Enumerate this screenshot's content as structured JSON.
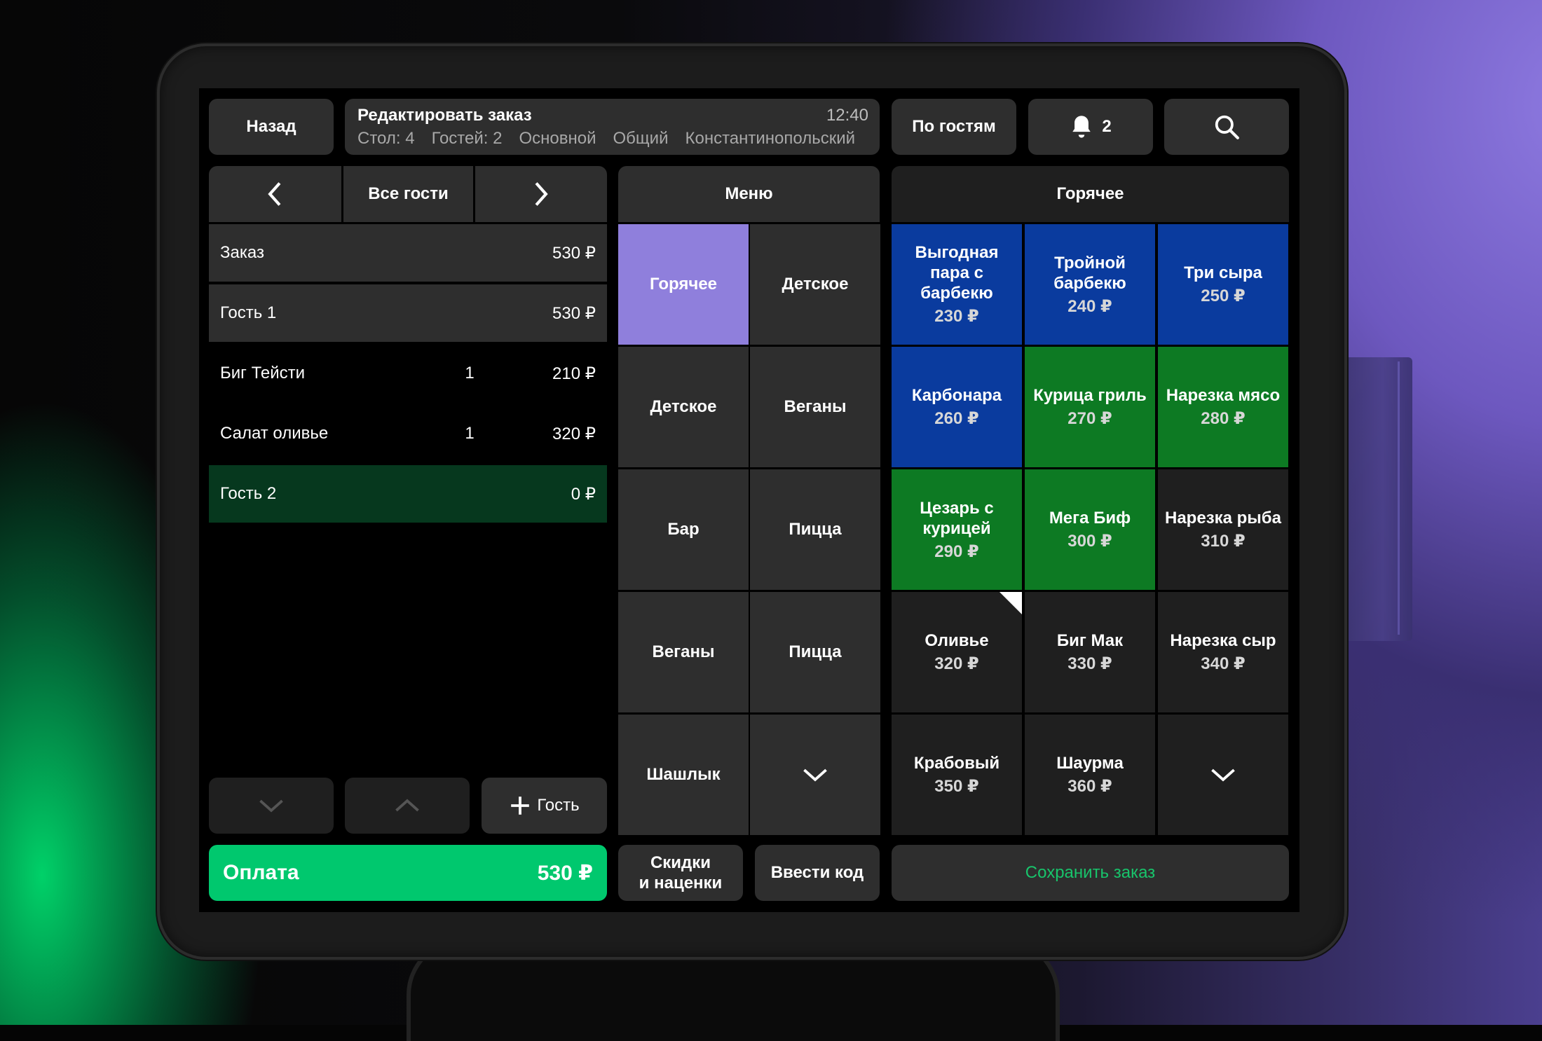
{
  "header": {
    "back_label": "Назад",
    "title": "Редактировать заказ",
    "time": "12:40",
    "table": "Стол: 4",
    "guests": "Гостей: 2",
    "hall": "Основной",
    "menu_type": "Общий",
    "waiter": "Константинопольский",
    "by_guests_label": "По гостям",
    "notifications_count": "2"
  },
  "guest_nav": {
    "label": "Все гости"
  },
  "order": {
    "summary_label": "Заказ",
    "summary_total": "530 ₽",
    "guests": [
      {
        "name": "Гость 1",
        "total": "530 ₽",
        "items": [
          {
            "name": "Биг Тейсти",
            "qty": "1",
            "price": "210 ₽"
          },
          {
            "name": "Салат оливье",
            "qty": "1",
            "price": "320 ₽"
          }
        ]
      },
      {
        "name": "Гость 2",
        "total": "0 ₽",
        "items": []
      }
    ]
  },
  "add_guest_label": "Гость",
  "pay": {
    "label": "Оплата",
    "amount": "530 ₽"
  },
  "discounts_label_1": "Скидки",
  "discounts_label_2": "и наценки",
  "enter_code_label": "Ввести код",
  "save_label": "Сохранить заказ",
  "menu": {
    "title": "Меню",
    "categories": [
      "Горячее",
      "Детское",
      "Детское",
      "Веганы",
      "Бар",
      "Пицца",
      "Веганы",
      "Пицца",
      "Шашлык"
    ]
  },
  "dishes": {
    "title": "Горячее",
    "items": [
      {
        "name": "Выгодная пара с барбекю",
        "price": "230 ₽"
      },
      {
        "name": "Тройной барбекю",
        "price": "240 ₽"
      },
      {
        "name": "Три сыра",
        "price": "250 ₽"
      },
      {
        "name": "Карбонара",
        "price": "260 ₽"
      },
      {
        "name": "Курица гриль",
        "price": "270 ₽"
      },
      {
        "name": "Нарезка мясо",
        "price": "280 ₽"
      },
      {
        "name": "Цезарь с курицей",
        "price": "290 ₽"
      },
      {
        "name": "Мега Биф",
        "price": "300 ₽"
      },
      {
        "name": "Нарезка рыба",
        "price": "310 ₽"
      },
      {
        "name": "Оливье",
        "price": "320 ₽"
      },
      {
        "name": "Биг Мак",
        "price": "330 ₽"
      },
      {
        "name": "Нарезка сыр",
        "price": "340 ₽"
      },
      {
        "name": "Крабовый",
        "price": "350 ₽"
      },
      {
        "name": "Шаурма",
        "price": "360 ₽"
      }
    ]
  },
  "colors": {
    "accent_green": "#00c86e",
    "selected_category": "#8f7fdc",
    "guest2_bg": "#06381e",
    "dish_blue": "#0a3b9e",
    "dish_green": "#0d7a23"
  }
}
